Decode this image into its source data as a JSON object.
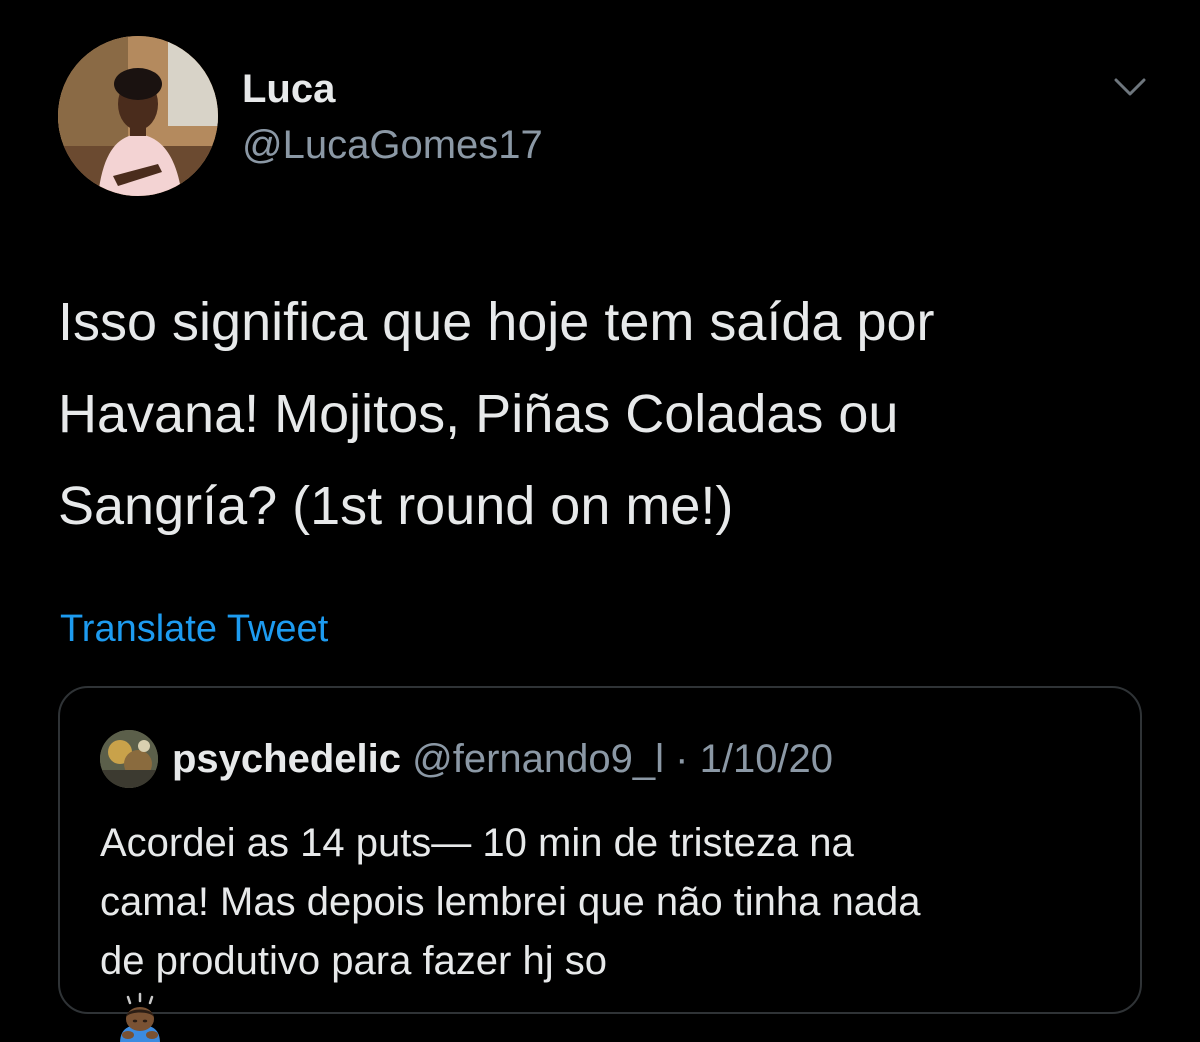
{
  "author": {
    "display_name": "Luca",
    "handle": "@LucaGomes17"
  },
  "menu_icon": "chevron-down-icon",
  "tweet": {
    "lines": [
      "Isso significa que hoje tem saída por",
      "Havana! Mojitos, Piñas Coladas ou",
      "Sangría? (1st round on me!)"
    ],
    "translate_label": "Translate Tweet"
  },
  "quoted": {
    "display_name": "psychedelic",
    "meta": "@fernando9_l · 1/10/20",
    "lines": [
      "Acordei as 14 puts— 10 min de tristeza na",
      "cama! Mas depois lembrei que não tinha nada",
      "de produtivo para fazer hj so"
    ],
    "trailing_emoji": "person-bowing-emoji"
  },
  "colors": {
    "background": "#000000",
    "primary_text": "#e7e9ea",
    "secondary_text": "#8b98a5",
    "link": "#1d9bf0",
    "border": "#2f3336"
  }
}
